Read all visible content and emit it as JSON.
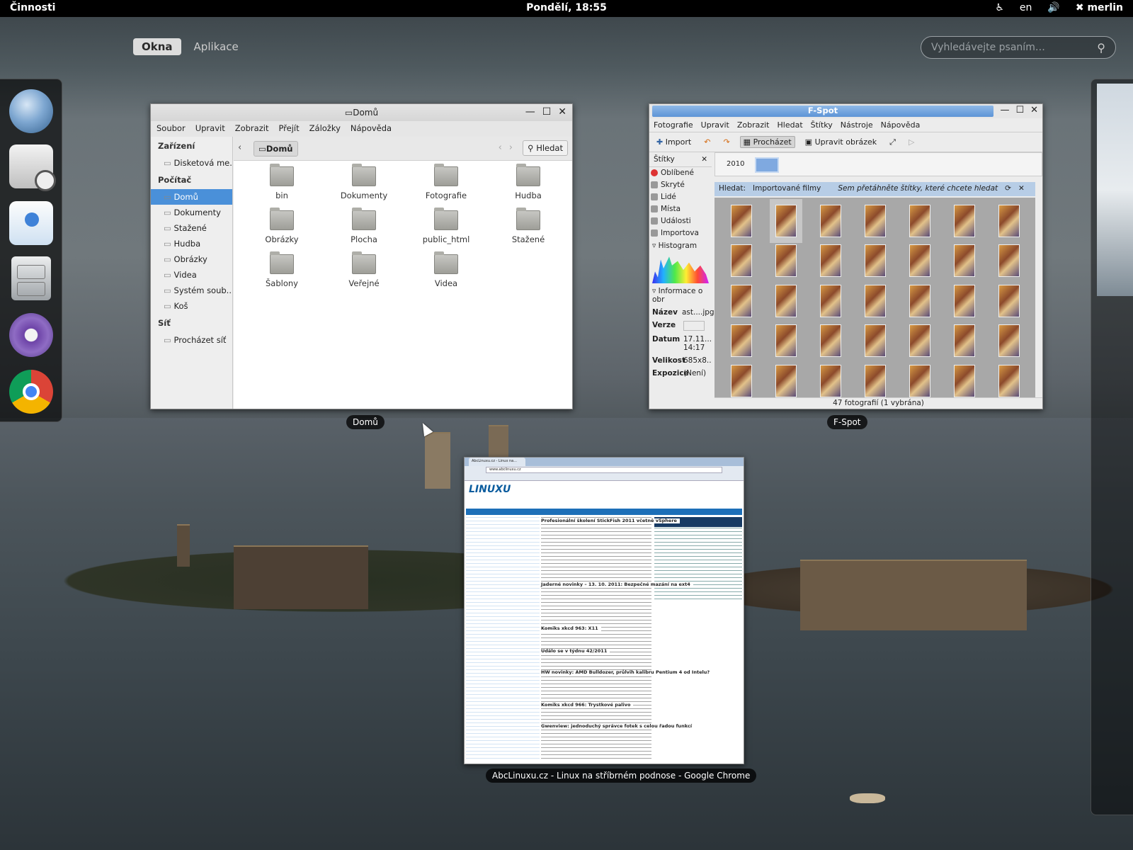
{
  "topbar": {
    "activities": "Činnosti",
    "clock": "Pondělí, 18:55",
    "language": "en",
    "user": "merlin"
  },
  "overview": {
    "tabs": [
      "Okna",
      "Aplikace"
    ],
    "active_tab": "Okna",
    "search_placeholder": "Vyhledávejte psaním…"
  },
  "dash": {
    "items": [
      "web-browser-globe-icon",
      "mail-clock-icon",
      "chat-icon",
      "file-cabinet-icon",
      "aperture-icon",
      "chrome-icon"
    ]
  },
  "windows": {
    "files": {
      "caption": "Domů",
      "title": "Domů",
      "menu": [
        "Soubor",
        "Upravit",
        "Zobrazit",
        "Přejít",
        "Záložky",
        "Nápověda"
      ],
      "sidebar": {
        "devices_header": "Zařízení",
        "devices": [
          "Disketová me..."
        ],
        "computer_header": "Počítač",
        "computer": [
          "Domů",
          "Dokumenty",
          "Stažené",
          "Hudba",
          "Obrázky",
          "Videa",
          "Systém soub...",
          "Koš"
        ],
        "network_header": "Síť",
        "network": [
          "Procházet síť"
        ]
      },
      "breadcrumb": "Domů",
      "search_label": "Hledat",
      "folders": [
        "bin",
        "Dokumenty",
        "Fotografie",
        "Hudba",
        "Obrázky",
        "Plocha",
        "public_html",
        "Stažené",
        "Šablony",
        "Veřejné",
        "Videa"
      ]
    },
    "fspot": {
      "caption": "F-Spot",
      "title": "F-Spot",
      "menu": [
        "Fotografie",
        "Upravit",
        "Zobrazit",
        "Hledat",
        "Štítky",
        "Nástroje",
        "Nápověda"
      ],
      "toolbar": {
        "import": "Import",
        "browse": "Procházet",
        "edit": "Upravit obrázek"
      },
      "tags_label": "Štítky",
      "tags": [
        "Oblíbené",
        "Skryté",
        "Lidé",
        "Místa",
        "Události",
        "Importova"
      ],
      "histogram_label": "Histogram",
      "info_label": "Informace o obr",
      "props": [
        {
          "k": "Název",
          "v": "ast....jpg"
        },
        {
          "k": "Verze",
          "v": ""
        },
        {
          "k": "Datum",
          "v": "17.11... 14:17"
        },
        {
          "k": "Velikost",
          "v": "685x8.."
        },
        {
          "k": "Expozice",
          "v": "(Není)"
        }
      ],
      "timeline_year": "2010",
      "find_label": "Hledat:",
      "find_value": "Importované filmy",
      "find_hint": "Sem přetáhněte štítky, které chcete hledat",
      "status": "47 fotografií (1 vybrána)"
    },
    "chrome": {
      "caption": "AbcLinuxu.cz - Linux na stříbrném podnose - Google Chrome",
      "tab": "AbcLinuxu.cz - Linux na...",
      "url": "www.abclinuxu.cz",
      "logo": "LINUXU",
      "headlines": [
        "Profesionální školení StickFish 2011 včetně vSphere",
        "Jaderné novinky – 13. 10. 2011: Bezpečné mazání na ext4",
        "Komiks xkcd 963: X11",
        "Událo se v týdnu 42/2011",
        "HW novinky: AMD Bulldozer, průlvih kalibru Pentium 4 od Intelu?",
        "Komiks xkcd 966: Trystkové palivo",
        "Gwenview: jednoduchý správce fotek s celou řadou funkcí"
      ]
    }
  }
}
